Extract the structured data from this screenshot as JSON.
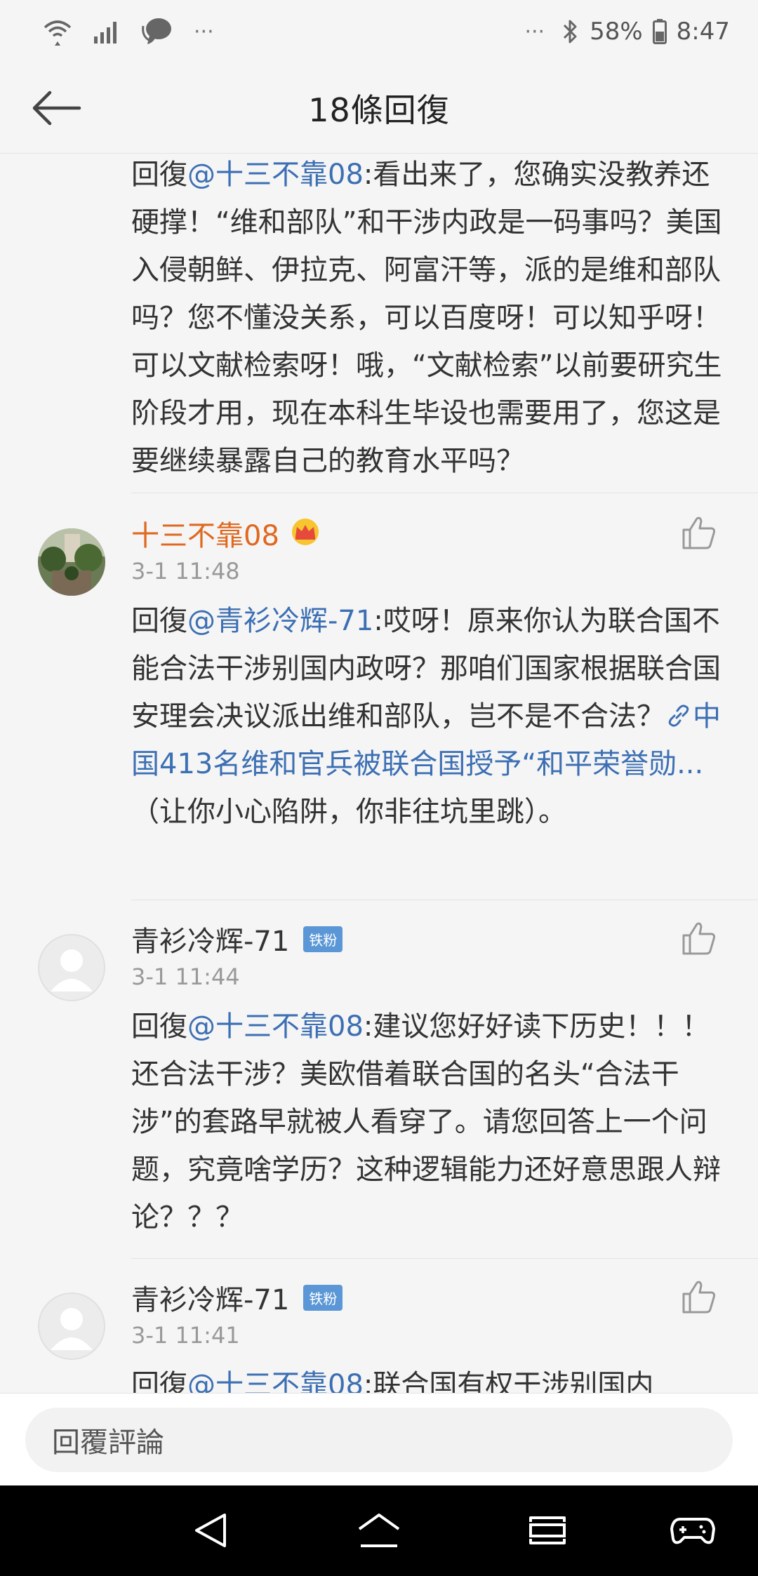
{
  "status_bar": {
    "left_icons": [
      "wifi-icon",
      "signal-icon",
      "chat-bubble-icon",
      "more-dots-icon"
    ],
    "left_more": "···",
    "right_more": "···",
    "battery": "58%",
    "time": "8:47"
  },
  "header": {
    "title": "18條回復",
    "back_icon": "arrow-left-icon"
  },
  "first_reply": {
    "prefix": "回復",
    "mention": "@十三不靠08",
    "text": ":看出来了，您确实没教养还硬撑！“维和部队”和干涉内政是一码事吗？美国入侵朝鲜、伊拉克、阿富汗等，派的是维和部队吗？您不懂没关系，可以百度呀！可以知乎呀！可以文献检索呀！哦，“文献检索”以前要研究生阶段才用，现在本科生毕设也需要用了，您这是要继续暴露自己的教育水平吗？"
  },
  "comments": [
    {
      "author": "十三不靠08",
      "author_icon": "crown-icon",
      "time": "3-1 11:48",
      "prefix": "回復",
      "mention": "@青衫冷辉-71",
      "text": ":哎呀！原来你认为联合国不能合法干涉别国内政呀？那咱们国家根据联合国安理会决议派出维和部队，岂不是不合法？",
      "link_icon": "link-icon",
      "link_text": "中国413名维和官兵被联合国授予“和平荣誉勋...",
      "tail": " （让你小心陷阱，你非往坑里跳）。"
    },
    {
      "author": "青衫冷辉-71",
      "badge": "铁粉",
      "time": "3-1 11:44",
      "prefix": "回復",
      "mention": "@十三不靠08",
      "text": ":建议您好好读下历史！！！还合法干涉？美欧借着联合国的名头“合法干涉”的套路早就被人看穿了。请您回答上一个问题，究竟啥学历？这种逻辑能力还好意思跟人辩论？？？"
    },
    {
      "author": "青衫冷辉-71",
      "badge": "铁粉",
      "time": "3-1 11:41",
      "prefix": "回復",
      "mention": "@十三不靠08",
      "text": ":联合国有权干涉别国内"
    }
  ],
  "input": {
    "placeholder": "回覆評論"
  },
  "nav_bar": {
    "buttons": [
      "back-triangle-icon",
      "home-icon",
      "recents-icon",
      "game-controller-icon"
    ]
  },
  "colors": {
    "mention": "#3c6fb3",
    "author_highlight": "#e0681f",
    "badge": "#5b97d6"
  }
}
